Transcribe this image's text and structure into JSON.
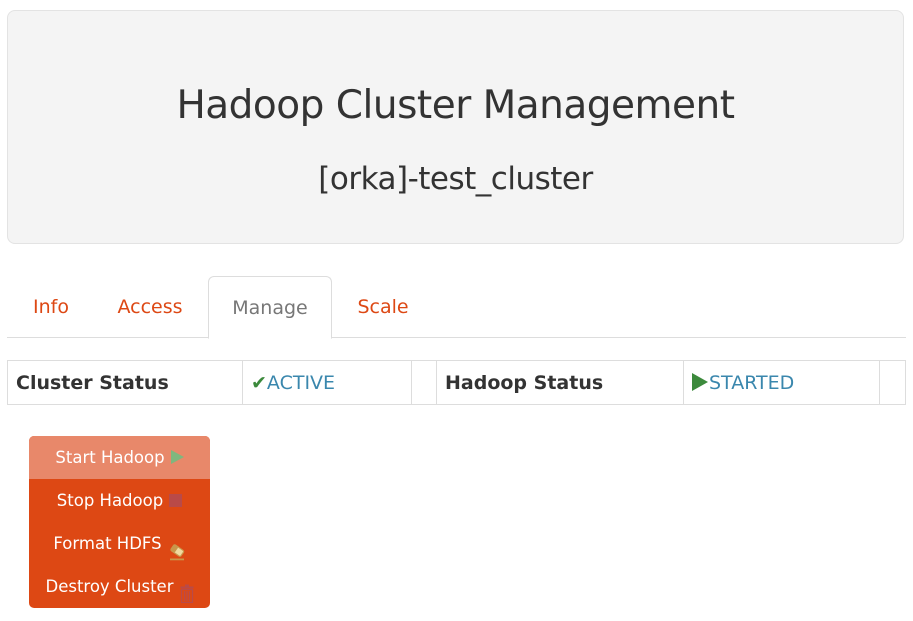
{
  "header": {
    "title": "Hadoop Cluster Management",
    "subtitle": "[orka]-test_cluster"
  },
  "tabs": [
    {
      "label": "Info",
      "active": false
    },
    {
      "label": "Access",
      "active": false
    },
    {
      "label": "Manage",
      "active": true
    },
    {
      "label": "Scale",
      "active": false
    }
  ],
  "status": {
    "cluster_label": "Cluster Status",
    "cluster_value": "ACTIVE",
    "cluster_icon": "checkmark-icon",
    "hadoop_label": "Hadoop Status",
    "hadoop_value": "STARTED",
    "hadoop_icon": "play-icon"
  },
  "actions": [
    {
      "label": "Start Hadoop",
      "icon": "play-icon",
      "active": true
    },
    {
      "label": "Stop Hadoop",
      "icon": "stop-icon",
      "active": false
    },
    {
      "label": "Format HDFS",
      "icon": "eraser-icon",
      "active": false
    },
    {
      "label": "Destroy Cluster",
      "icon": "trash-icon",
      "active": false
    }
  ],
  "colors": {
    "accent": "#dd4814",
    "active_menu": "#e8886a",
    "status_text": "#3a87ad",
    "success": "#3c8a3c",
    "danger": "#b94a48"
  }
}
